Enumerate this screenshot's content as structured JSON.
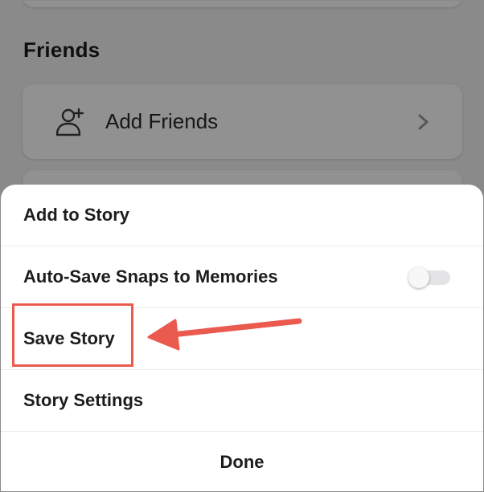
{
  "background": {
    "section_title": "Friends",
    "add_friends_label": "Add Friends"
  },
  "sheet": {
    "items": [
      {
        "label": "Add to Story"
      },
      {
        "label": "Auto-Save Snaps to Memories",
        "toggle_on": false
      },
      {
        "label": "Save Story",
        "highlighted": true
      },
      {
        "label": "Story Settings"
      }
    ],
    "done_label": "Done"
  },
  "annotation": {
    "color": "#ea5a4e",
    "target": "Save Story"
  }
}
